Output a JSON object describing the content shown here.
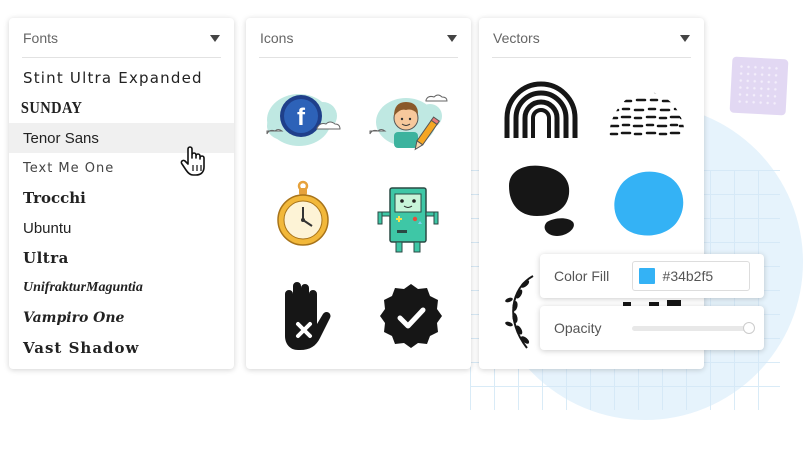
{
  "fonts_panel": {
    "title": "Fonts",
    "items": [
      "Stint Ultra Expanded",
      "SUNDAY",
      "Tenor Sans",
      "Text Me One",
      "Trocchi",
      "Ubuntu",
      "Ultra",
      "UnifrakturMaguntia",
      "Vampiro One",
      "Vast Shadow"
    ],
    "hovered_index": 2
  },
  "icons_panel": {
    "title": "Icons",
    "icons": [
      "facebook-cloud-icon",
      "avatar-pencil-icon",
      "pocket-watch-icon",
      "robot-icon",
      "hand-x-icon",
      "check-badge-icon"
    ]
  },
  "vectors_panel": {
    "title": "Vectors",
    "vectors": [
      "rainbow-arcs-vector",
      "dotted-dome-vector",
      "black-blob-vector",
      "blue-blob-vector",
      "laurel-wreath-vector",
      "partial-shape-vector"
    ]
  },
  "color_fill": {
    "label": "Color Fill",
    "value": "#34b2f5"
  },
  "opacity": {
    "label": "Opacity",
    "value": 1.0
  },
  "colors": {
    "accent_blue": "#34b2f5",
    "background_circle": "#e6f3fc",
    "decor_square": "#e2d8f3"
  }
}
